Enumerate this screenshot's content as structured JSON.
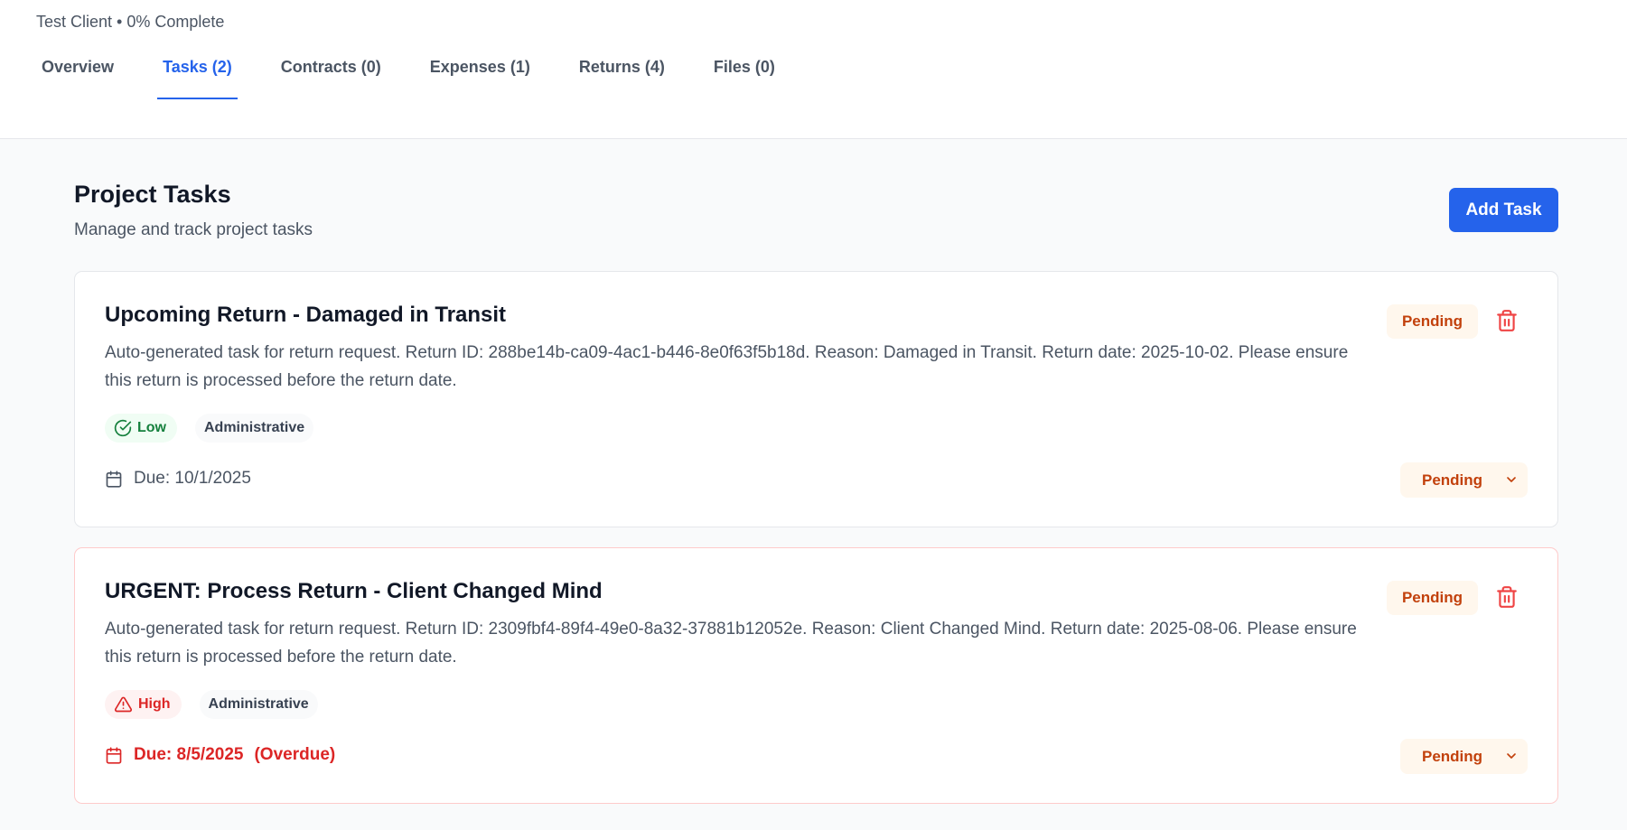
{
  "header": {
    "subtitle": "Test Client • 0% Complete",
    "tabs": [
      {
        "label": "Overview",
        "active": false
      },
      {
        "label": "Tasks (2)",
        "active": true
      },
      {
        "label": "Contracts (0)",
        "active": false
      },
      {
        "label": "Expenses (1)",
        "active": false
      },
      {
        "label": "Returns (4)",
        "active": false
      },
      {
        "label": "Files (0)",
        "active": false
      }
    ]
  },
  "section": {
    "title": "Project Tasks",
    "subtitle": "Manage and track project tasks",
    "add_button": "Add Task"
  },
  "tasks": [
    {
      "title": "Upcoming Return - Damaged in Transit",
      "description": "Auto-generated task for return request. Return ID: 288be14b-ca09-4ac1-b446-8e0f63f5b18d. Reason: Damaged in Transit. Return date: 2025-10-02. Please ensure this return is processed before the return date.",
      "status_badge": "Pending",
      "priority": "Low",
      "priority_icon": "check-circle-icon",
      "category": "Administrative",
      "due": "Due: 10/1/2025",
      "overdue": "",
      "status_select": "Pending"
    },
    {
      "title": "URGENT: Process Return - Client Changed Mind",
      "description": "Auto-generated task for return request. Return ID: 2309fbf4-89f4-49e0-8a32-37881b12052e. Reason: Client Changed Mind. Return date: 2025-08-06. Please ensure this return is processed before the return date.",
      "status_badge": "Pending",
      "priority": "High",
      "priority_icon": "alert-triangle-icon",
      "category": "Administrative",
      "due": "Due: 8/5/2025",
      "overdue": "(Overdue)",
      "status_select": "Pending"
    }
  ],
  "colors": {
    "accent": "#2563eb",
    "pending_bg": "#fff7ed",
    "pending_text": "#c2410c",
    "low_text": "#15803d",
    "high_text": "#dc2626"
  }
}
